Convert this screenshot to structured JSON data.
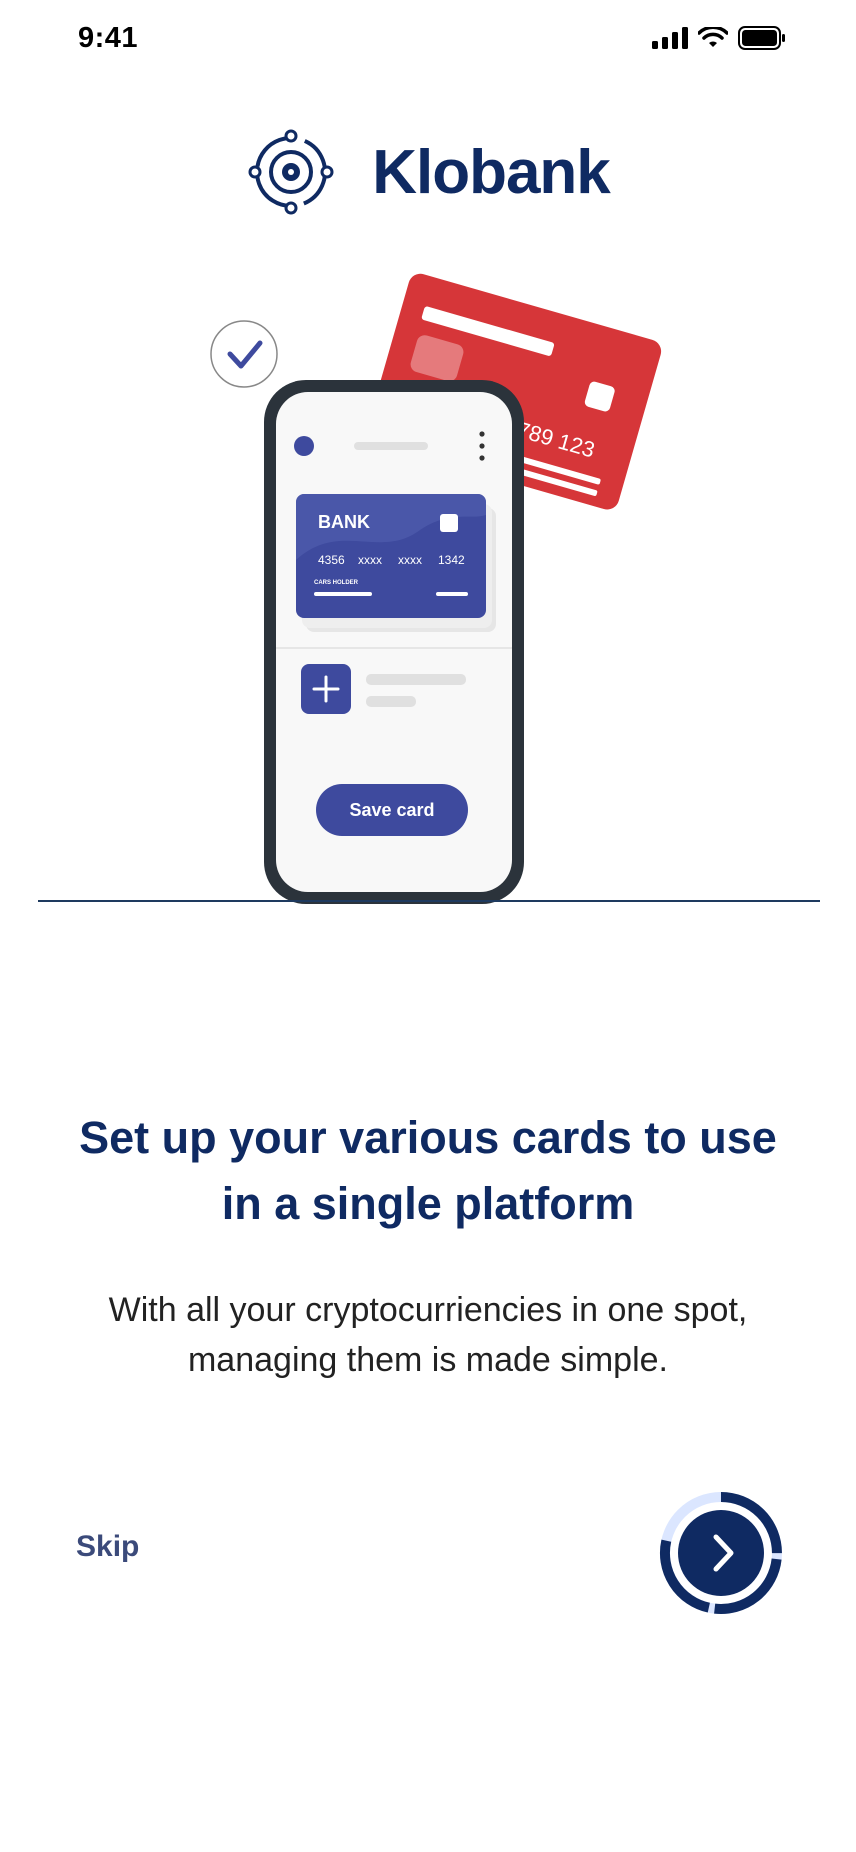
{
  "status_bar": {
    "time": "9:41"
  },
  "brand": {
    "name": "Klobank"
  },
  "illustration": {
    "bank_card": {
      "bank_label": "BANK",
      "number_groups": [
        "4356",
        "xxxx",
        "xxxx",
        "1342"
      ],
      "holder_label": "CARS HOLDER"
    },
    "red_card_number": "789 123",
    "save_button_label": "Save card"
  },
  "onboarding": {
    "headline": "Set up your various cards to use in a single platform",
    "subtext": "With all your cryptocurriencies in one spot, managing them is made simple.",
    "skip_label": "Skip"
  },
  "colors": {
    "primary": "#0f2a62",
    "accent": "#3e4a9e",
    "red_card": "#d63639",
    "ring_light": "#dbe6ff"
  }
}
